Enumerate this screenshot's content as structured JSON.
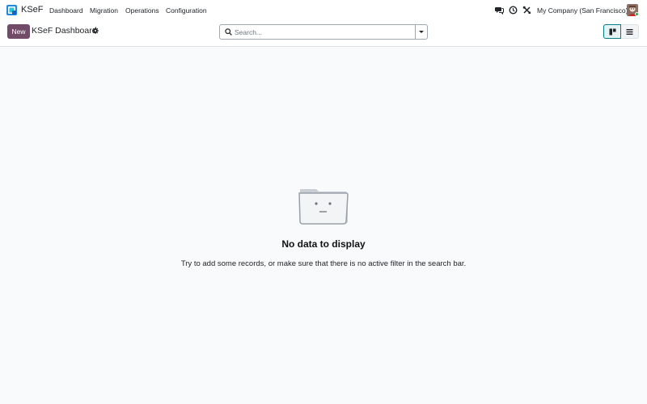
{
  "navbar": {
    "app_name": "KSeF",
    "menu": [
      {
        "label": "Dashboard"
      },
      {
        "label": "Migration"
      },
      {
        "label": "Operations"
      },
      {
        "label": "Configuration"
      }
    ],
    "company": "My Company (San Francisco)",
    "icons": [
      "chat-icon",
      "activity-clock-icon",
      "debug-tools-icon"
    ]
  },
  "control_panel": {
    "new_label": "New",
    "title": "KSeF Dashboard",
    "search": {
      "placeholder": "Search...",
      "value": ""
    },
    "views": [
      {
        "name": "kanban",
        "active": true
      },
      {
        "name": "list",
        "active": false
      }
    ]
  },
  "empty_state": {
    "title": "No data to display",
    "text": "Try to add some records, or make sure that there is no active filter in the search bar."
  },
  "colors": {
    "brand": "#714b67",
    "accent": "#017e84",
    "background": "#f9fafb"
  }
}
